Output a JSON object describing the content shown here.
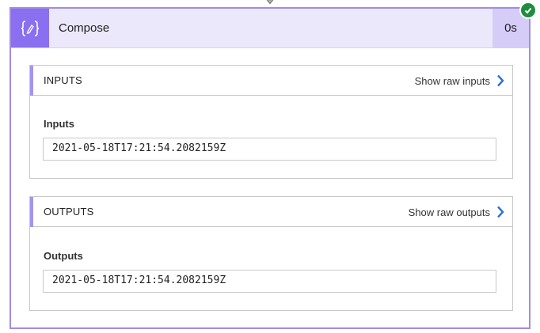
{
  "action": {
    "title": "Compose",
    "duration": "0s",
    "status": "succeeded",
    "icon": "compose-curly-braces-icon",
    "colors": {
      "accent": "#8a6ff0",
      "header_bg": "#ece8fb",
      "border": "#a08ce6",
      "success": "#1e8e3e",
      "link_chevron": "#2b6fd6"
    }
  },
  "inputs": {
    "section_title": "INPUTS",
    "raw_link": "Show raw inputs",
    "field_label": "Inputs",
    "field_value": "2021-05-18T17:21:54.2082159Z"
  },
  "outputs": {
    "section_title": "OUTPUTS",
    "raw_link": "Show raw outputs",
    "field_label": "Outputs",
    "field_value": "2021-05-18T17:21:54.2082159Z"
  }
}
